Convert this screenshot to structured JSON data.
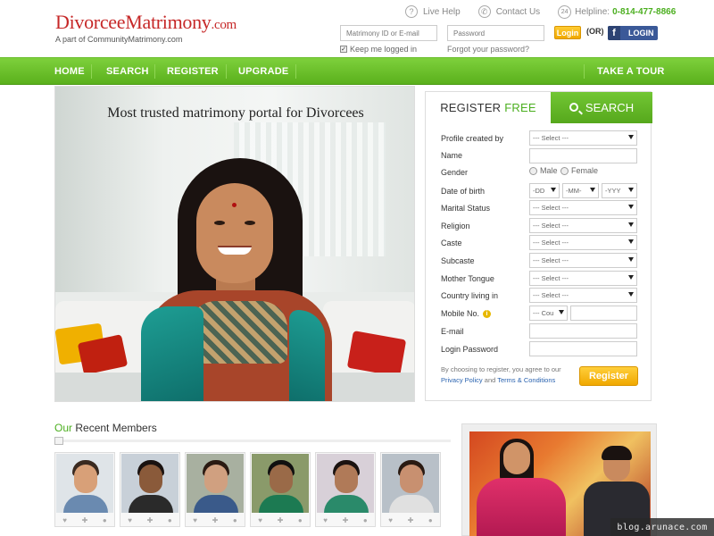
{
  "header": {
    "logo_main": "DivorceeMatrimony",
    "logo_dotcom": ".com",
    "logo_sub": "A part of CommunityMatrimony.com",
    "live_help": "Live Help",
    "contact_us": "Contact Us",
    "helpline_label": "Helpline:",
    "helpline_number": "0-814-477-8866",
    "helpline_icon_text": "24",
    "id_placeholder": "Matrimony ID or E-mail",
    "password_placeholder": "Password",
    "login_label": "Login",
    "or_label": "(OR)",
    "fb_login_label": "LOGIN",
    "keep_logged_in": "Keep me logged in",
    "keep_logged_in_checked": true,
    "forgot_password": "Forgot your password?"
  },
  "nav": {
    "items": [
      "HOME",
      "SEARCH",
      "REGISTER",
      "UPGRADE"
    ],
    "take_a_tour": "TAKE A TOUR"
  },
  "hero": {
    "tagline": "Most trusted matrimony portal for Divorcees"
  },
  "register": {
    "tab_register": "REGISTER",
    "tab_free": "FREE",
    "tab_search": "SEARCH",
    "labels": {
      "profile_created_by": "Profile created by",
      "name": "Name",
      "gender": "Gender",
      "dob": "Date of birth",
      "marital_status": "Marital Status",
      "religion": "Religion",
      "caste": "Caste",
      "subcaste": "Subcaste",
      "mother_tongue": "Mother Tongue",
      "country": "Country living in",
      "mobile": "Mobile No.",
      "email": "E-mail",
      "login_password": "Login Password"
    },
    "select_placeholder": "--- Select ---",
    "gender_male": "Male",
    "gender_female": "Female",
    "dob_dd": "-DD",
    "dob_mm": "-MM-",
    "dob_yyyy": "-YYY",
    "mobile_code": "--- Cou",
    "terms_text": "By choosing to register, you agree to our",
    "privacy_policy": "Privacy Policy",
    "terms_and": "and",
    "terms_conditions": "Terms & Conditions",
    "register_button": "Register"
  },
  "members": {
    "title_our": "Our",
    "title_rest": "Recent Members",
    "list": [
      {
        "skin": "#d8a078",
        "hair": "#3a2a20",
        "shirt": "#6a8ab0",
        "bg": "#dfe4e8"
      },
      {
        "skin": "#8a5a3a",
        "hair": "#1a1210",
        "shirt": "#2a2a2a",
        "bg": "#c8d0d8"
      },
      {
        "skin": "#d0a080",
        "hair": "#2a1a12",
        "shirt": "#3a5a8a",
        "bg": "#a8b0a0"
      },
      {
        "skin": "#9a6a48",
        "hair": "#101010",
        "shirt": "#1c7a52",
        "bg": "#8a9a6a"
      },
      {
        "skin": "#b07a58",
        "hair": "#1a1210",
        "shirt": "#2a8a6a",
        "bg": "#d8d0d8"
      },
      {
        "skin": "#c89070",
        "hair": "#2a1a12",
        "shirt": "#e0e0e0",
        "bg": "#b8c0c8"
      }
    ],
    "action_icons": [
      "heart-icon",
      "pin-icon",
      "chat-icon"
    ],
    "action_glyphs": [
      "♥",
      "✚",
      "●"
    ]
  },
  "watermark": "blog.arunace.com",
  "colors": {
    "brand_green": "#5ab01c",
    "logo_red": "#c62828",
    "accent_orange": "#f0a800",
    "facebook_blue": "#3b5998"
  }
}
